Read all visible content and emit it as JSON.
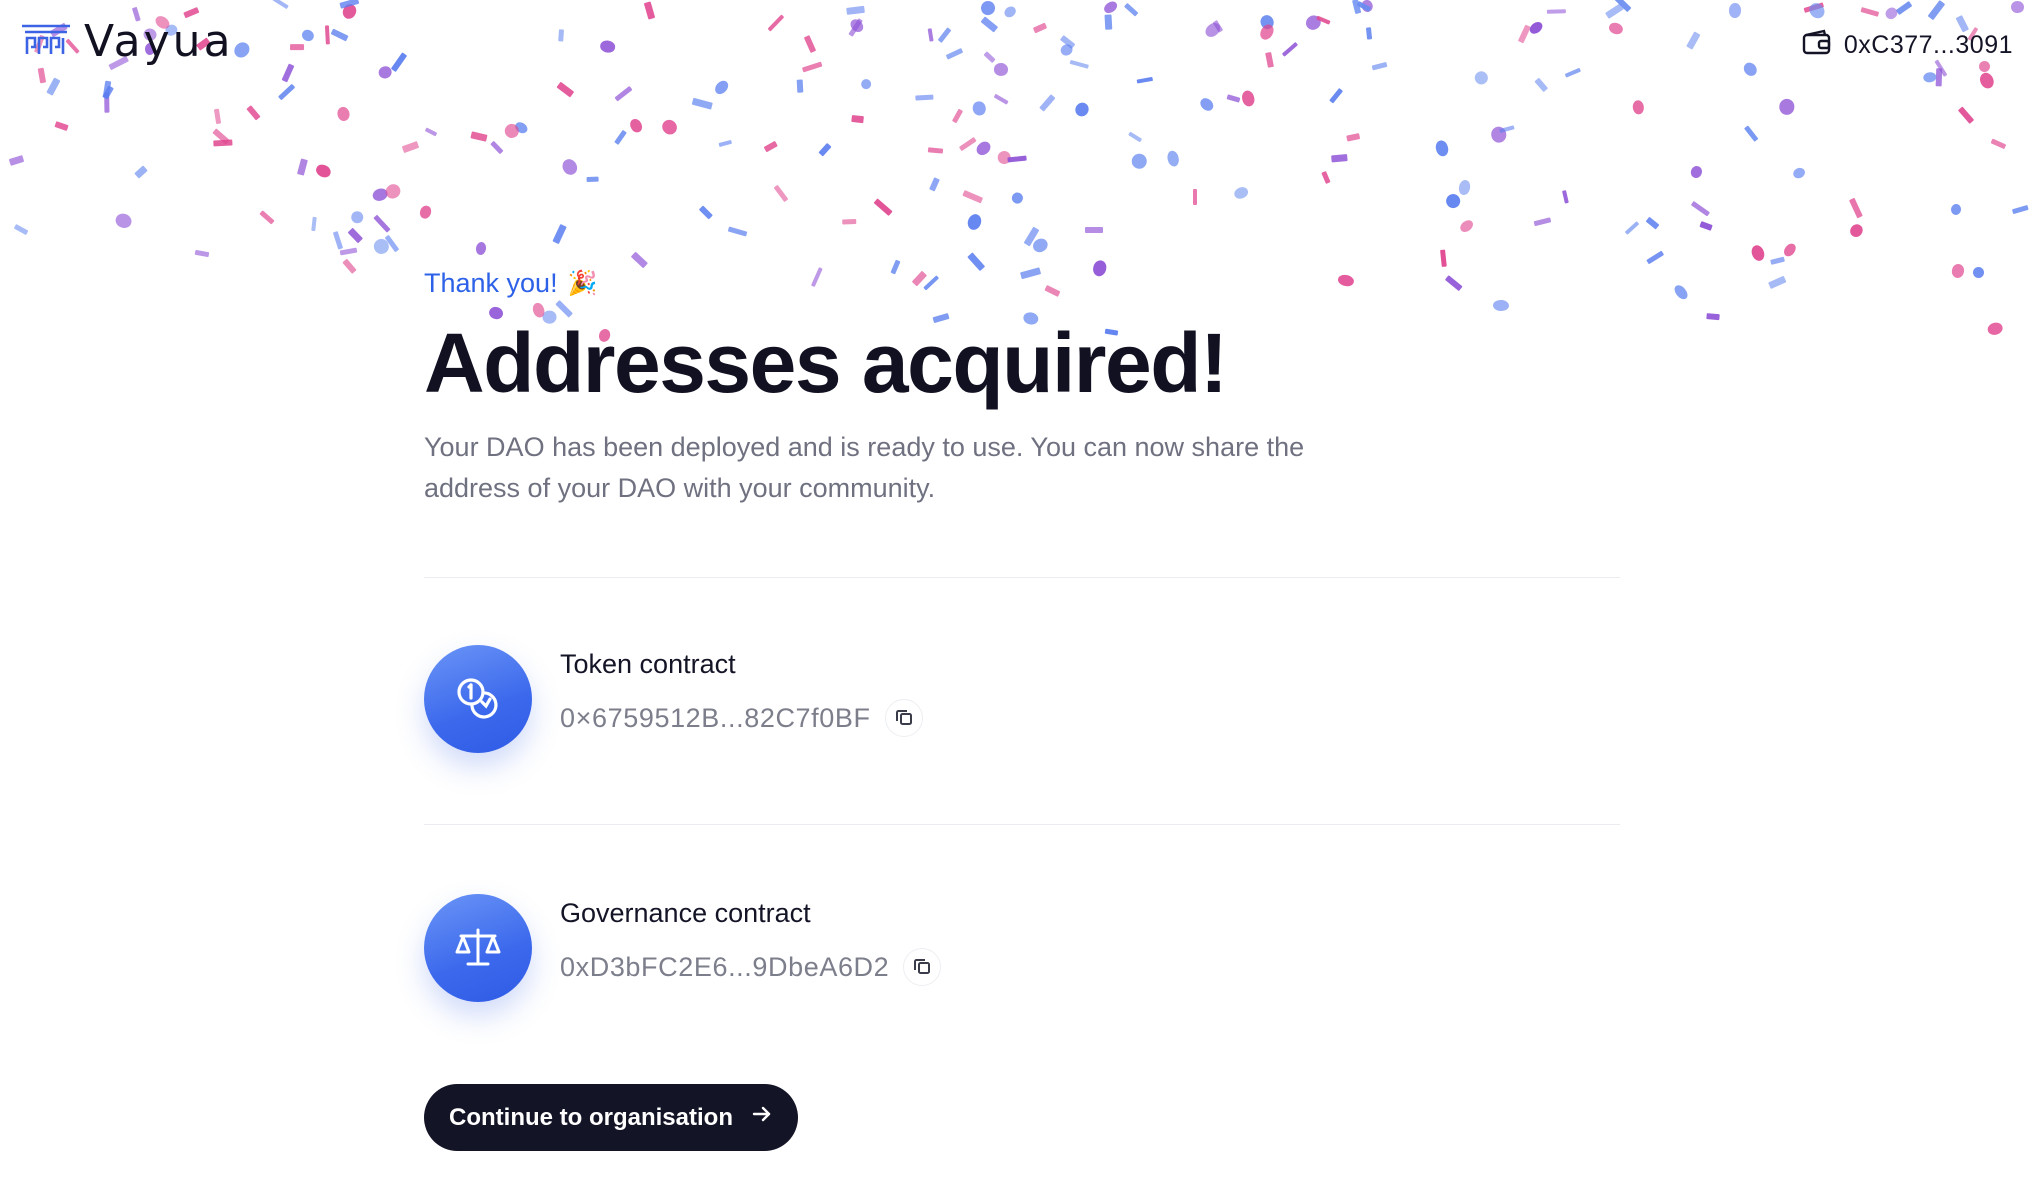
{
  "header": {
    "logo_text": "Vayua",
    "wallet_address": "0xC377...3091"
  },
  "main": {
    "eyebrow": "Thank you!",
    "eyebrow_emoji": "🎉",
    "title": "Addresses acquired!",
    "subtitle": "Your DAO has been deployed and is ready to use. You can now share the address of your DAO with your community.",
    "contracts": [
      {
        "title": "Token contract",
        "address": "0×6759512B...82C7f0BF",
        "icon": "coins-icon"
      },
      {
        "title": "Governance contract",
        "address": "0xD3bFC2E6...9DbeA6D2",
        "icon": "scales-icon"
      }
    ],
    "continue_label": "Continue to organisation"
  },
  "colors": {
    "accent": "#2d62e8",
    "icon_gradient_start": "#6b95f7",
    "icon_gradient_end": "#2f5be6",
    "button_bg": "#141427",
    "confetti": [
      "#e0468f",
      "#6a8cf0",
      "#8e52d6",
      "#5b7ef0"
    ]
  }
}
